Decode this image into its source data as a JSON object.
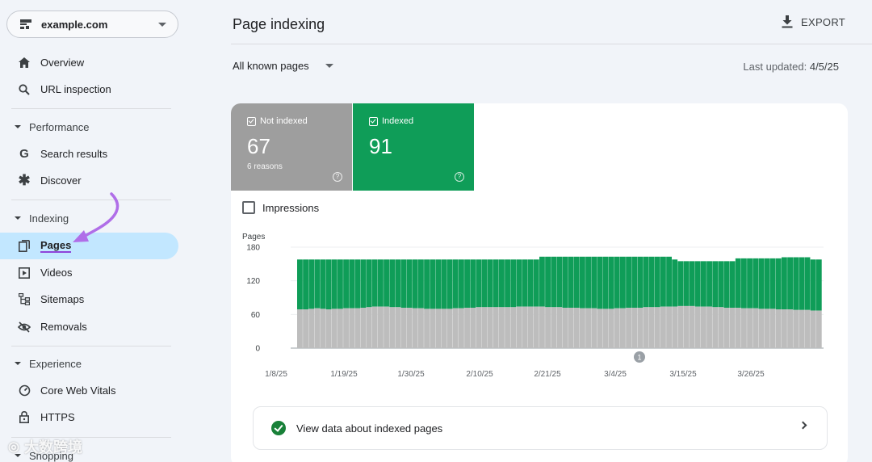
{
  "property": {
    "domain": "example.com"
  },
  "sidebar": {
    "overview": "Overview",
    "url_inspection": "URL inspection",
    "performance": "Performance",
    "search_results": "Search results",
    "discover": "Discover",
    "indexing": "Indexing",
    "pages": "Pages",
    "videos": "Videos",
    "sitemaps": "Sitemaps",
    "removals": "Removals",
    "experience": "Experience",
    "core_web_vitals": "Core Web Vitals",
    "https": "HTTPS",
    "shopping": "Shopping"
  },
  "header": {
    "title": "Page indexing",
    "export": "EXPORT"
  },
  "filter": {
    "selected": "All known pages"
  },
  "updated": {
    "label": "Last updated:",
    "date": "4/5/25"
  },
  "tiles": {
    "not_indexed": {
      "label": "Not indexed",
      "count": "67",
      "sub": "6 reasons"
    },
    "indexed": {
      "label": "Indexed",
      "count": "91"
    }
  },
  "impressions_label": "Impressions",
  "view_data": "View data about indexed pages",
  "watermark": "大数跨境",
  "colors": {
    "indexed": "#0f9d58",
    "not_indexed": "#bdbdbd",
    "active_nav": "#c2e7ff",
    "annotation": "#b06ee8"
  },
  "chart_data": {
    "type": "bar",
    "stacked": true,
    "ylabel": "Pages",
    "ylim": [
      0,
      180
    ],
    "yticks": [
      "180",
      "120",
      "60",
      "0"
    ],
    "xtick_labels": [
      "1/8/25",
      "1/19/25",
      "1/30/25",
      "2/10/25",
      "2/21/25",
      "3/4/25",
      "3/15/25",
      "3/26/25"
    ],
    "annotation_marker": "1",
    "series": [
      {
        "name": "Not indexed",
        "values": [
          69,
          69,
          70,
          70,
          70,
          69,
          69,
          70,
          70,
          70,
          70,
          70,
          70,
          70,
          70,
          71,
          71,
          71,
          71,
          71,
          71,
          71,
          70,
          70,
          70,
          70,
          70,
          69,
          69,
          69,
          70,
          70,
          70,
          70,
          70,
          70,
          69,
          70,
          70,
          70,
          71,
          71,
          71,
          71,
          71,
          71,
          71,
          71,
          71,
          71,
          71,
          71,
          71,
          71,
          71,
          71,
          71,
          71,
          71,
          71,
          72,
          72,
          72,
          72,
          72,
          72,
          72,
          73,
          73,
          73,
          73,
          73,
          74,
          74,
          74,
          74,
          74,
          74,
          74,
          74,
          74,
          74,
          74,
          74,
          74,
          74,
          74,
          74,
          73,
          73,
          73,
          73,
          73,
          73,
          73,
          73,
          73,
          72,
          72,
          72,
          72,
          72,
          72,
          72,
          72,
          72,
          72,
          72,
          72,
          72,
          72,
          72,
          71,
          71,
          71,
          71,
          71,
          71,
          71,
          71,
          70,
          70,
          70,
          70,
          70,
          70,
          70,
          70,
          70,
          70,
          70,
          70,
          70,
          70,
          70,
          70,
          70,
          70,
          70,
          70,
          70,
          70,
          70,
          70,
          70,
          70,
          70,
          70,
          71,
          71,
          71,
          71,
          71,
          71,
          71,
          71,
          71,
          71,
          71,
          71,
          72,
          72,
          72,
          72,
          72,
          72,
          72,
          72,
          72,
          72,
          72,
          72,
          73,
          73,
          73,
          73,
          73,
          73,
          73,
          73,
          73,
          73,
          73,
          73,
          73,
          73,
          73,
          73,
          73,
          73,
          73,
          73,
          73,
          73,
          73,
          73,
          73,
          73,
          73,
          73,
          73,
          73,
          73,
          73,
          73,
          73,
          73,
          73,
          73,
          73,
          73,
          73,
          74,
          74,
          74,
          74,
          74,
          74,
          74,
          74,
          74,
          74,
          74,
          74,
          74,
          74,
          74,
          74,
          74,
          74,
          74,
          74,
          74,
          74,
          74,
          74,
          74,
          74,
          74,
          74,
          73,
          73,
          73,
          73,
          73,
          73,
          73,
          73,
          73,
          73,
          73,
          73,
          73,
          73,
          73,
          73,
          72,
          72,
          72,
          72,
          72,
          72,
          72,
          72,
          72,
          72,
          72,
          72,
          72,
          72,
          72,
          72,
          71,
          71,
          71,
          71,
          71,
          71,
          71,
          71,
          71,
          71,
          71,
          71,
          71,
          71,
          71,
          71,
          70,
          70,
          70,
          70,
          70,
          70,
          70,
          70,
          70,
          70,
          70,
          70,
          70,
          70,
          70,
          70,
          71,
          71,
          71,
          71,
          71,
          71,
          71,
          71,
          71,
          71,
          71,
          71,
          71,
          71,
          71,
          71,
          72,
          72,
          72,
          72,
          72,
          72,
          72,
          72,
          72,
          72,
          72,
          72,
          72,
          72,
          72,
          72,
          73,
          73,
          73,
          73,
          73,
          73,
          73,
          73,
          73,
          73,
          73,
          73,
          73,
          73,
          73,
          73,
          74,
          74,
          74,
          74,
          74,
          74,
          74,
          74,
          74,
          74,
          74,
          74,
          74,
          74,
          74,
          74,
          75,
          75,
          75,
          75,
          75,
          75,
          75,
          75,
          75,
          75,
          75,
          75,
          75,
          75,
          75,
          75,
          74,
          74,
          74,
          74,
          74,
          74,
          74,
          74,
          74,
          74,
          74,
          74,
          74,
          74,
          74,
          74,
          73,
          73,
          73,
          73,
          73,
          73,
          73,
          73,
          73,
          73,
          73,
          73,
          73,
          73,
          73,
          73,
          72,
          72,
          72,
          72,
          72,
          72,
          72,
          72,
          72,
          72,
          72,
          72,
          72,
          72,
          72,
          72,
          71,
          71,
          71,
          71,
          71,
          71,
          71,
          71,
          71,
          71,
          71,
          71,
          71,
          71,
          71,
          71,
          70,
          70,
          70,
          70,
          70,
          70,
          70,
          70,
          70,
          70,
          70,
          70,
          70,
          70,
          70,
          70,
          69,
          69,
          69,
          69,
          69,
          69,
          69,
          69,
          69,
          69,
          69,
          69,
          69,
          69,
          69,
          69,
          68,
          68,
          68,
          68,
          68,
          68,
          68,
          68,
          68,
          68,
          68,
          68,
          68,
          68,
          68,
          68,
          67,
          67,
          67,
          67,
          67,
          67,
          67,
          67,
          67,
          67,
          67,
          67,
          67,
          67,
          67,
          67
        ]
      },
      {
        "name": "Indexed",
        "values": []
      }
    ]
  }
}
